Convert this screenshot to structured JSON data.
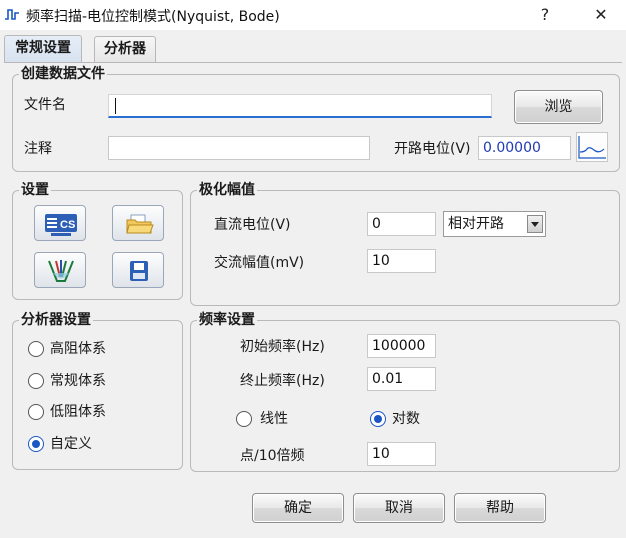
{
  "window": {
    "title": "频率扫描-电位控制模式(Nyquist, Bode)",
    "help_label": "?",
    "close_label": "✕"
  },
  "tabs": [
    {
      "label": "常规设置",
      "active": true
    },
    {
      "label": "分析器",
      "active": false
    }
  ],
  "create_file": {
    "title": "创建数据文件",
    "filename_label": "文件名",
    "filename_value": "",
    "browse_label": "浏览",
    "note_label": "注释",
    "note_value": "",
    "ocp_label": "开路电位(V)",
    "ocp_value": "0.00000"
  },
  "settings": {
    "title": "设置",
    "icons": [
      "cs-icon",
      "open-folder-icon",
      "electrode-icon",
      "save-disk-icon"
    ],
    "cs_text": "CS"
  },
  "polarization": {
    "title": "极化幅值",
    "dc_label": "直流电位(V)",
    "dc_value": "0",
    "dc_ref": "相对开路",
    "ac_label": "交流幅值(mV)",
    "ac_value": "10"
  },
  "analyzer": {
    "title": "分析器设置",
    "options": [
      {
        "label": "高阻体系",
        "selected": false
      },
      {
        "label": "常规体系",
        "selected": false
      },
      {
        "label": "低阻体系",
        "selected": false
      },
      {
        "label": "自定义",
        "selected": true
      }
    ]
  },
  "frequency": {
    "title": "频率设置",
    "start_label": "初始频率(Hz)",
    "start_value": "100000",
    "end_label": "终止频率(Hz)",
    "end_value": "0.01",
    "linear_label": "线性",
    "log_label": "对数",
    "log_selected": true,
    "points_label": "点/10倍频",
    "points_value": "10"
  },
  "footer": {
    "ok_label": "确定",
    "cancel_label": "取消",
    "help_label": "帮助"
  },
  "colors": {
    "accent": "#1a56c4",
    "value_blue": "#1f3ab5"
  }
}
